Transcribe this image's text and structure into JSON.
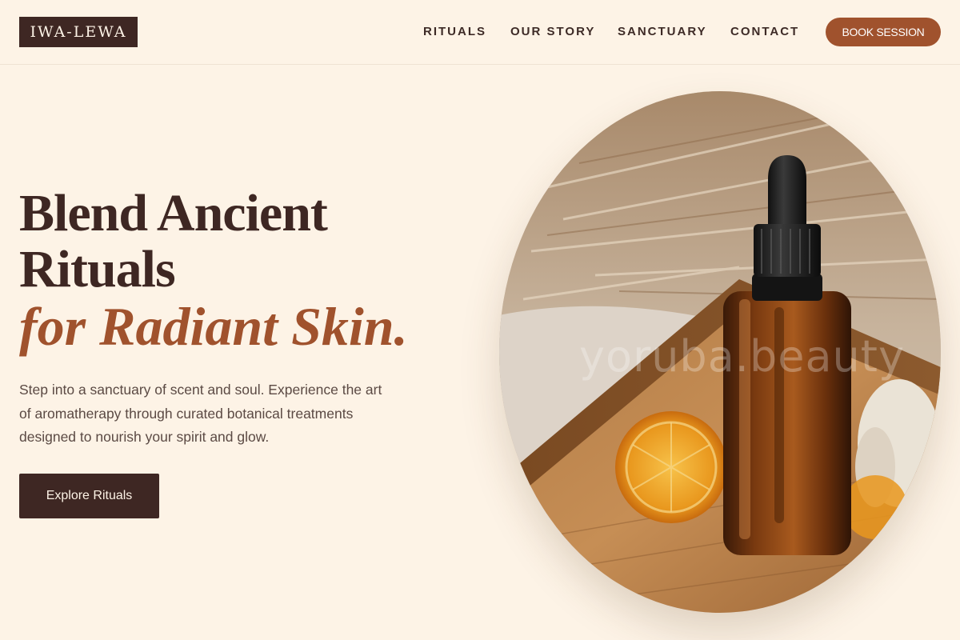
{
  "brand": {
    "logo_text": "IWA-LEWA"
  },
  "nav": {
    "items": [
      {
        "label": "RITUALS"
      },
      {
        "label": "OUR STORY"
      },
      {
        "label": "SANCTUARY"
      },
      {
        "label": "CONTACT"
      }
    ],
    "cta_label": "BOOK SESSION"
  },
  "hero": {
    "headline_line1": "Blend Ancient",
    "headline_line2": "Rituals",
    "headline_accent": "for Radiant Skin.",
    "subcopy": "Step into a sanctuary of scent and soul. Experience the art of aromatherapy through curated botanical treatments designed to nourish your spirit and glow.",
    "cta_label": "Explore Rituals",
    "image_watermark": "yoruba.beauty",
    "image_subject": "amber-dropper-bottle-with-dried-orange-on-wooden-tray"
  },
  "colors": {
    "background": "#fdf3e6",
    "primary_dark": "#3e2723",
    "accent": "#a0522d",
    "body_text": "#5b4a44"
  }
}
